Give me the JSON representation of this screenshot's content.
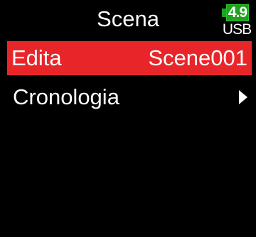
{
  "header": {
    "title": "Scena",
    "battery_level": "4.9",
    "power_source": "USB"
  },
  "menu": {
    "items": [
      {
        "label": "Edita",
        "value": "Scene001",
        "selected": true
      },
      {
        "label": "Cronologia",
        "icon": "chevron-right-icon",
        "selected": false
      }
    ]
  },
  "colors": {
    "background": "#000000",
    "selected_highlight": "#e8262a",
    "battery_fill": "#1fa21f",
    "text": "#ffffff"
  }
}
